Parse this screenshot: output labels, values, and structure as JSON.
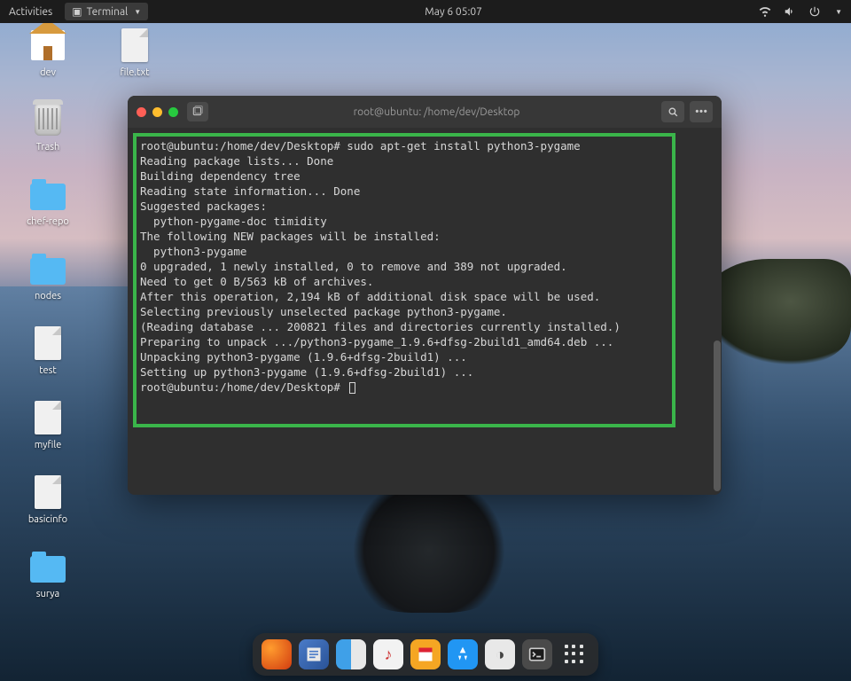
{
  "top_panel": {
    "activities": "Activities",
    "app_menu": "Terminal",
    "datetime": "May 6  05:07"
  },
  "desktop_icons": [
    {
      "name": "dev",
      "type": "home"
    },
    {
      "name": "file.txt",
      "type": "file"
    },
    {
      "name": "Trash",
      "type": "trash"
    },
    {
      "name": "chef-repo",
      "type": "folder"
    },
    {
      "name": "nodes",
      "type": "folder"
    },
    {
      "name": "test",
      "type": "file"
    },
    {
      "name": "myfile",
      "type": "file"
    },
    {
      "name": "basicinfo",
      "type": "file"
    },
    {
      "name": "surya",
      "type": "folder"
    }
  ],
  "terminal": {
    "title": "root@ubuntu: /home/dev/Desktop",
    "prompt": "root@ubuntu:/home/dev/Desktop#",
    "command": "sudo apt-get install python3-pygame",
    "lines": [
      "Reading package lists... Done",
      "Building dependency tree",
      "Reading state information... Done",
      "Suggested packages:",
      "  python-pygame-doc timidity",
      "The following NEW packages will be installed:",
      "  python3-pygame",
      "0 upgraded, 1 newly installed, 0 to remove and 389 not upgraded.",
      "Need to get 0 B/563 kB of archives.",
      "After this operation, 2,194 kB of additional disk space will be used.",
      "Selecting previously unselected package python3-pygame.",
      "(Reading database ... 200821 files and directories currently installed.)",
      "Preparing to unpack .../python3-pygame_1.9.6+dfsg-2build1_amd64.deb ...",
      "Unpacking python3-pygame (1.9.6+dfsg-2build1) ...",
      "Setting up python3-pygame (1.9.6+dfsg-2build1) ..."
    ]
  },
  "dock": [
    {
      "id": "firefox",
      "label": "Firefox"
    },
    {
      "id": "text",
      "label": "Text Editor"
    },
    {
      "id": "finder",
      "label": "Files"
    },
    {
      "id": "music",
      "label": "Music"
    },
    {
      "id": "office",
      "label": "Office"
    },
    {
      "id": "store",
      "label": "App Store"
    },
    {
      "id": "sys",
      "label": "System"
    },
    {
      "id": "term",
      "label": "Terminal"
    },
    {
      "id": "apps",
      "label": "Show Applications"
    }
  ]
}
